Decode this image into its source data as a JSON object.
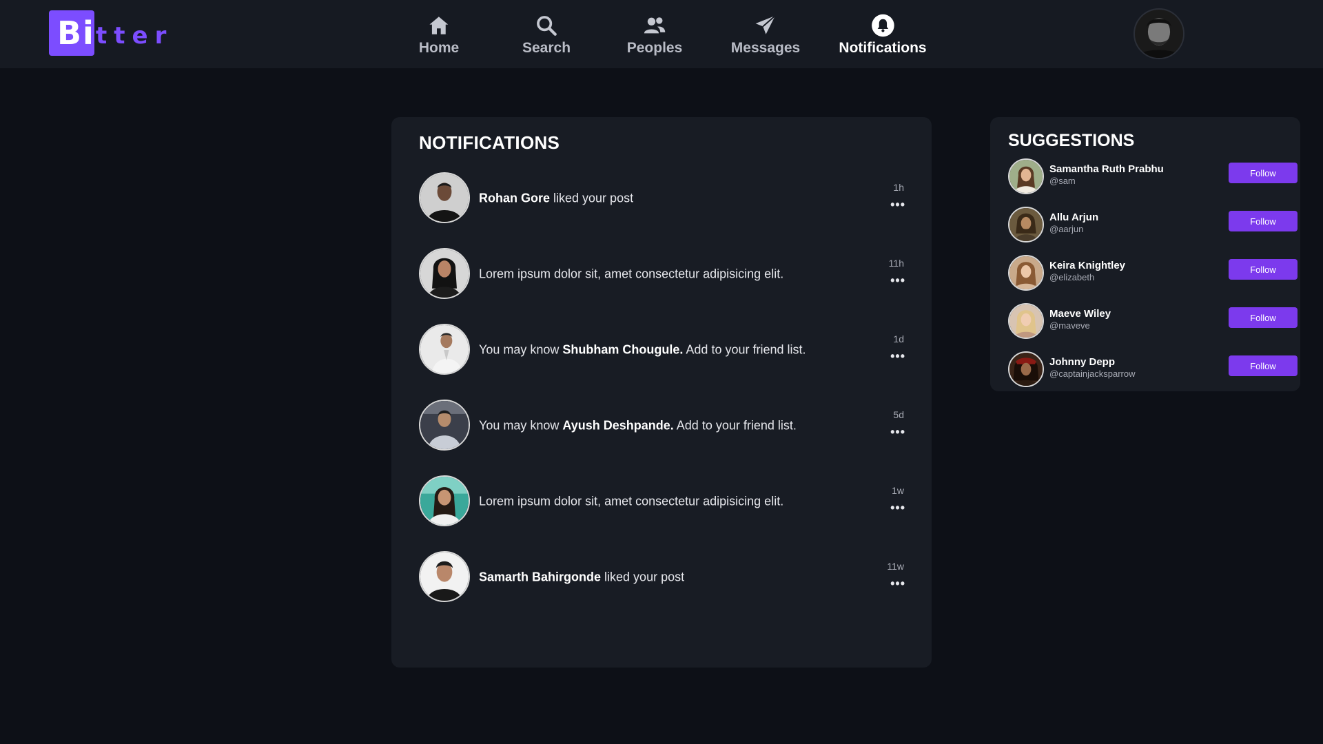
{
  "brand": {
    "logo_box_text": "Bi",
    "logo_rest_text": "tter"
  },
  "nav": {
    "items": [
      {
        "label": "Home",
        "icon": "home-icon"
      },
      {
        "label": "Search",
        "icon": "search-icon"
      },
      {
        "label": "Peoples",
        "icon": "people-icon"
      },
      {
        "label": "Messages",
        "icon": "send-icon"
      },
      {
        "label": "Notifications",
        "icon": "bell-icon",
        "active": true
      }
    ]
  },
  "colors": {
    "accent": "#7c3aed",
    "background": "#0d1017",
    "panel": "#181c24",
    "topbar": "#161a22"
  },
  "notifications": {
    "title": "NOTIFICATIONS",
    "items": [
      {
        "bold": "Rohan Gore",
        "text": " liked your post",
        "time": "1h",
        "more": "•••"
      },
      {
        "text": "Lorem ipsum dolor sit, amet consectetur adipisicing elit.",
        "time": "11h",
        "more": "•••"
      },
      {
        "prefix": "You may know ",
        "bold": "Shubham Chougule.",
        "text": " Add to your friend list.",
        "time": "1d",
        "more": "•••"
      },
      {
        "prefix": "You may know ",
        "bold": "Ayush Deshpande.",
        "text": " Add to your friend list.",
        "time": "5d",
        "more": "•••"
      },
      {
        "text": "Lorem ipsum dolor sit, amet consectetur adipisicing elit.",
        "time": "1w",
        "more": "•••"
      },
      {
        "bold": "Samarth Bahirgonde",
        "text": " liked your post",
        "time": "11w",
        "more": "•••"
      }
    ]
  },
  "suggestions": {
    "title": "SUGGESTIONS",
    "follow_label": "Follow",
    "items": [
      {
        "name": "Samantha Ruth Prabhu",
        "handle": "@sam"
      },
      {
        "name": "Allu Arjun",
        "handle": "@aarjun"
      },
      {
        "name": "Keira Knightley",
        "handle": "@elizabeth"
      },
      {
        "name": "Maeve Wiley",
        "handle": "@maveve"
      },
      {
        "name": "Johnny Depp",
        "handle": "@captainjacksparrow"
      }
    ]
  }
}
